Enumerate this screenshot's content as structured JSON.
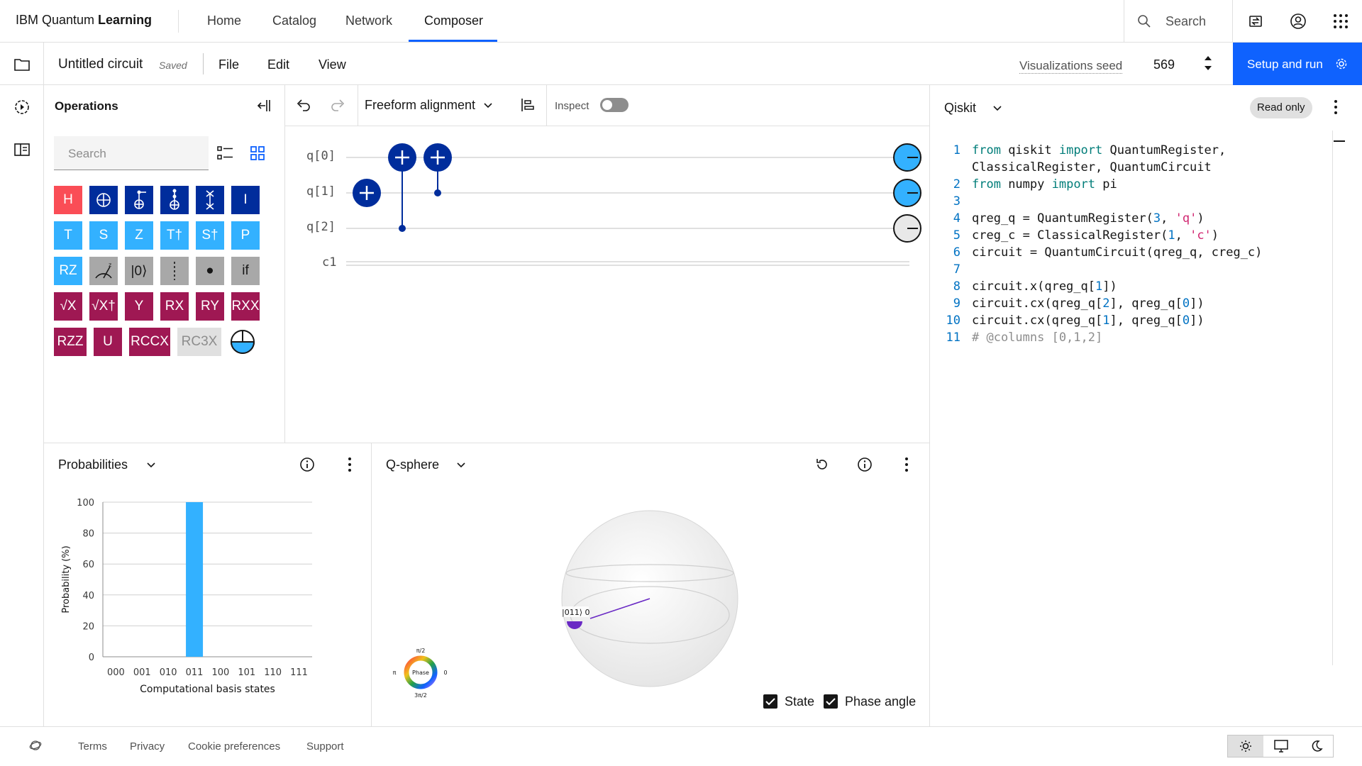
{
  "brand": {
    "prefix": "IBM Quantum ",
    "bold": "Learning"
  },
  "nav": {
    "home": "Home",
    "catalog": "Catalog",
    "network": "Network",
    "composer": "Composer",
    "active": "Composer"
  },
  "topbar": {
    "search_label": "Search",
    "icons": [
      "switch-icon",
      "user-avatar-icon",
      "app-switcher-icon"
    ]
  },
  "toolbar": {
    "circuit_title": "Untitled circuit",
    "saved": "Saved",
    "menu": {
      "file": "File",
      "edit": "Edit",
      "view": "View"
    },
    "seed_label": "Visualizations seed",
    "seed_value": "569",
    "run_label": "Setup and run"
  },
  "operations": {
    "title": "Operations",
    "search_placeholder": "Search",
    "gates": [
      {
        "label": "H",
        "color": "#fa4d56"
      },
      {
        "label": "",
        "icon": "cnot-icon",
        "color": "#002d9c"
      },
      {
        "label": "",
        "icon": "toffoli-icon",
        "color": "#002d9c"
      },
      {
        "label": "",
        "icon": "ccx-icon",
        "color": "#002d9c"
      },
      {
        "label": "",
        "icon": "swap-icon",
        "color": "#002d9c"
      },
      {
        "label": "I",
        "color": "#002d9c"
      },
      {
        "label": "T",
        "color": "#33b1ff"
      },
      {
        "label": "S",
        "color": "#33b1ff"
      },
      {
        "label": "Z",
        "color": "#33b1ff"
      },
      {
        "label": "T†",
        "color": "#33b1ff"
      },
      {
        "label": "S†",
        "color": "#33b1ff"
      },
      {
        "label": "P",
        "color": "#33b1ff"
      },
      {
        "label": "RZ",
        "color": "#33b1ff"
      },
      {
        "label": "",
        "icon": "measure-z-icon",
        "color": "#a8a8a8"
      },
      {
        "label": "|0⟩",
        "color": "#a8a8a8"
      },
      {
        "label": "",
        "icon": "barrier-icon",
        "color": "#a8a8a8"
      },
      {
        "label": "●",
        "color": "#a8a8a8"
      },
      {
        "label": "if",
        "color": "#a8a8a8"
      },
      {
        "label": "√X",
        "color": "#9f1853"
      },
      {
        "label": "√X†",
        "color": "#9f1853"
      },
      {
        "label": "Y",
        "color": "#9f1853"
      },
      {
        "label": "RX",
        "color": "#9f1853"
      },
      {
        "label": "RY",
        "color": "#9f1853"
      },
      {
        "label": "RXX",
        "color": "#9f1853"
      },
      {
        "label": "RZZ",
        "color": "#9f1853"
      },
      {
        "label": "U",
        "color": "#9f1853"
      },
      {
        "label": "RCCX",
        "color": "#9f1853"
      },
      {
        "label": "RC3X",
        "color": "#e0e0e0"
      },
      {
        "label": "",
        "icon": "half-circle-icon",
        "color": "#33b1ff"
      }
    ]
  },
  "circuit": {
    "alignment": "Freeform alignment",
    "inspect_label": "Inspect",
    "inspect_on": false,
    "qubits": [
      "q[0]",
      "q[1]",
      "q[2]"
    ],
    "classical": "c1"
  },
  "code": {
    "language": "Qiskit",
    "badge": "Read only",
    "lines": [
      {
        "n": "1",
        "segs": [
          [
            "kw",
            "from"
          ],
          [
            "t",
            " qiskit "
          ],
          [
            "kw",
            "import"
          ],
          [
            "t",
            " QuantumRegister,"
          ]
        ]
      },
      {
        "n": "",
        "segs": [
          [
            "t",
            "ClassicalRegister, QuantumCircuit"
          ]
        ]
      },
      {
        "n": "2",
        "segs": [
          [
            "kw",
            "from"
          ],
          [
            "t",
            " numpy "
          ],
          [
            "kw",
            "import"
          ],
          [
            "t",
            " pi"
          ]
        ]
      },
      {
        "n": "3",
        "segs": []
      },
      {
        "n": "4",
        "segs": [
          [
            "t",
            "qreg_q = QuantumRegister("
          ],
          [
            "num",
            "3"
          ],
          [
            "t",
            ", "
          ],
          [
            "str",
            "'q'"
          ],
          [
            "t",
            ")"
          ]
        ]
      },
      {
        "n": "5",
        "segs": [
          [
            "t",
            "creg_c = ClassicalRegister("
          ],
          [
            "num",
            "1"
          ],
          [
            "t",
            ", "
          ],
          [
            "str",
            "'c'"
          ],
          [
            "t",
            ")"
          ]
        ]
      },
      {
        "n": "6",
        "segs": [
          [
            "t",
            "circuit = QuantumCircuit(qreg_q, creg_c)"
          ]
        ]
      },
      {
        "n": "7",
        "segs": []
      },
      {
        "n": "8",
        "segs": [
          [
            "t",
            "circuit.x(qreg_q["
          ],
          [
            "num",
            "1"
          ],
          [
            "t",
            "])"
          ]
        ]
      },
      {
        "n": "9",
        "segs": [
          [
            "t",
            "circuit.cx(qreg_q["
          ],
          [
            "num",
            "2"
          ],
          [
            "t",
            "], qreg_q["
          ],
          [
            "num",
            "0"
          ],
          [
            "t",
            "])"
          ]
        ]
      },
      {
        "n": "10",
        "segs": [
          [
            "t",
            "circuit.cx(qreg_q["
          ],
          [
            "num",
            "1"
          ],
          [
            "t",
            "], qreg_q["
          ],
          [
            "num",
            "0"
          ],
          [
            "t",
            "])"
          ]
        ]
      },
      {
        "n": "11",
        "segs": [
          [
            "cmt",
            "# @columns [0,1,2]"
          ]
        ]
      }
    ]
  },
  "probabilities": {
    "title": "Probabilities",
    "chart_data": {
      "type": "bar",
      "categories": [
        "000",
        "001",
        "010",
        "011",
        "100",
        "101",
        "110",
        "111"
      ],
      "values": [
        0,
        0,
        0,
        100,
        0,
        0,
        0,
        0
      ],
      "xlabel": "Computational basis states",
      "ylabel": "Probability (%)",
      "ylim": [
        0,
        100
      ],
      "yticks": [
        "0",
        "20",
        "40",
        "60",
        "80",
        "100"
      ],
      "color": "#33b1ff",
      "grid": true
    }
  },
  "qsphere": {
    "title": "Q-sphere",
    "state_label": "|011⟩ 0",
    "phase": {
      "center": "Phase",
      "top": "π/2",
      "left": "π",
      "right": "0",
      "bottom": "3π/2"
    },
    "checkboxes": [
      {
        "label": "State",
        "checked": true
      },
      {
        "label": "Phase angle",
        "checked": true
      }
    ]
  },
  "footer": {
    "links": [
      "Terms",
      "Privacy",
      "Cookie preferences",
      "Support"
    ],
    "theme": "light"
  }
}
